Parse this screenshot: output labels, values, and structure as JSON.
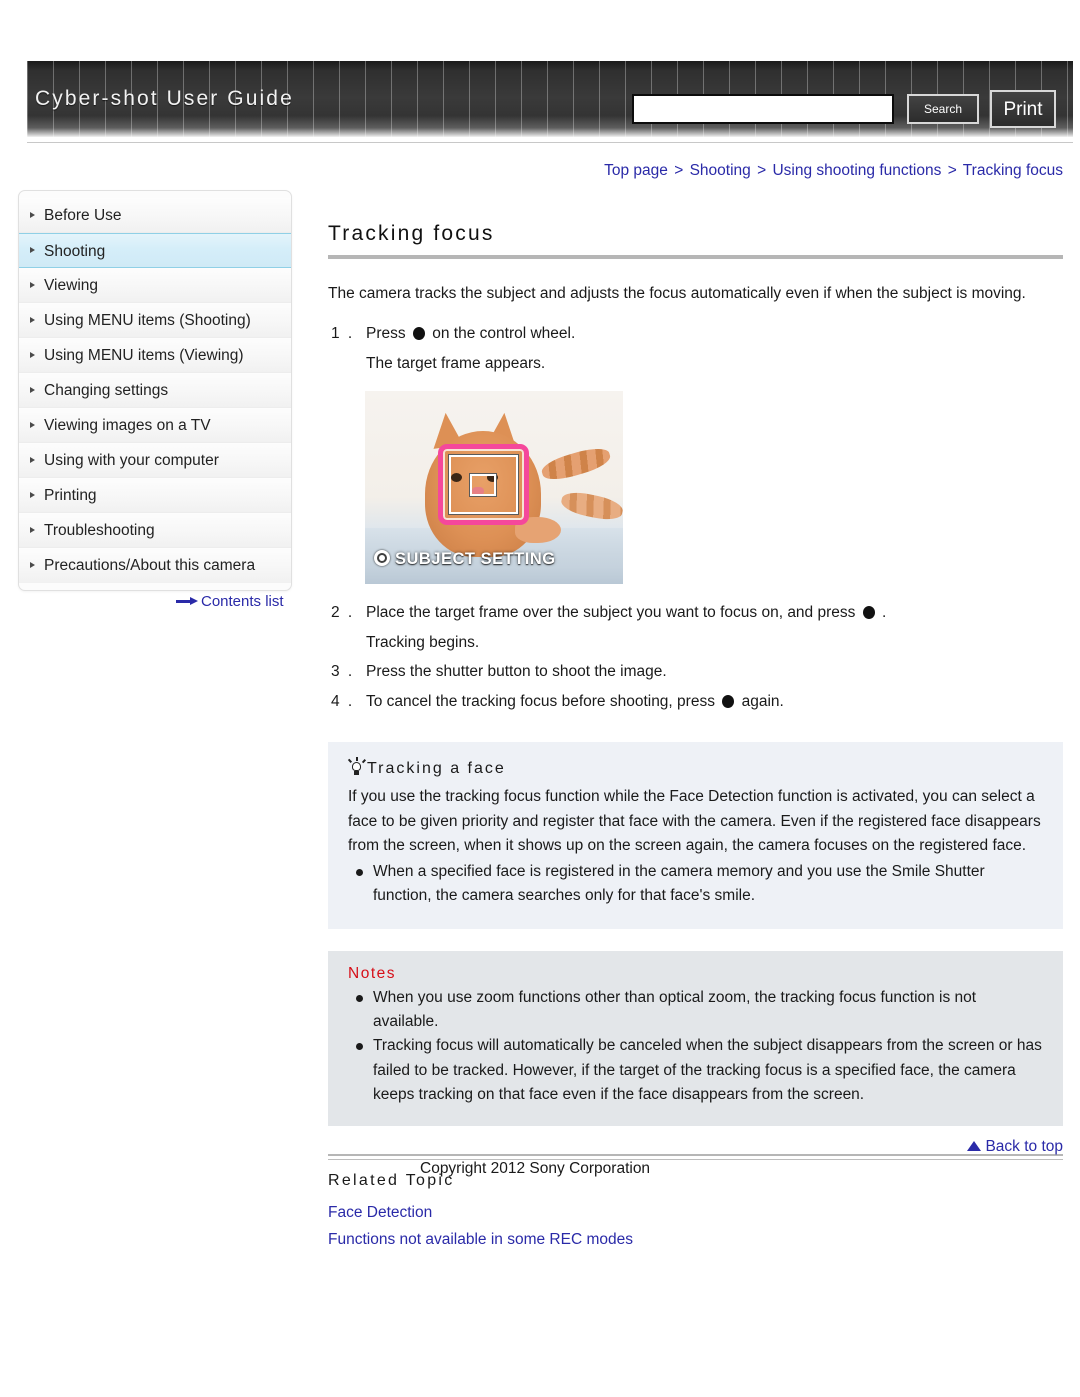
{
  "header": {
    "site_title": "Cyber-shot User Guide",
    "search_value": "",
    "search_placeholder": "",
    "search_button": "Search",
    "print_button": "Print"
  },
  "breadcrumb": {
    "items": [
      "Top page",
      "Shooting",
      "Using shooting functions",
      "Tracking focus"
    ],
    "separator": ">"
  },
  "sidebar": {
    "items": [
      {
        "label": "Before Use",
        "active": false
      },
      {
        "label": "Shooting",
        "active": true
      },
      {
        "label": "Viewing",
        "active": false
      },
      {
        "label": "Using MENU items (Shooting)",
        "active": false
      },
      {
        "label": "Using MENU items (Viewing)",
        "active": false
      },
      {
        "label": "Changing settings",
        "active": false
      },
      {
        "label": "Viewing images on a TV",
        "active": false
      },
      {
        "label": "Using with your computer",
        "active": false
      },
      {
        "label": "Printing",
        "active": false
      },
      {
        "label": "Troubleshooting",
        "active": false
      },
      {
        "label": "Precautions/About this camera",
        "active": false
      }
    ],
    "contents_list_label": "Contents list"
  },
  "main": {
    "title": "Tracking focus",
    "intro": "The camera tracks the subject and adjusts the focus automatically even if when the subject is moving.",
    "steps": [
      {
        "num": "1 .",
        "text_before": "Press",
        "has_dot": true,
        "text_after": "on the control wheel.",
        "sub": "The target frame appears."
      },
      {
        "num": "2 .",
        "text_before": "Place the target frame over the subject you want to focus on, and press",
        "has_dot": true,
        "text_after": ".",
        "sub": "Tracking begins."
      },
      {
        "num": "3 .",
        "text_before": "Press the shutter button to shoot the image.",
        "has_dot": false,
        "text_after": "",
        "sub": ""
      },
      {
        "num": "4 .",
        "text_before": "To cancel the tracking focus before shooting, press",
        "has_dot": true,
        "text_after": "again.",
        "sub": ""
      }
    ],
    "screenshot": {
      "osd_label": "SUBJECT SETTING"
    },
    "tip": {
      "title": "Tracking a face",
      "paragraph": "If you use the tracking focus function while the Face Detection function is activated, you can select a face to be given priority and register that face with the camera. Even if the registered face disappears from the screen, when it shows up on the screen again, the camera focuses on the registered face.",
      "bullets": [
        "When a specified face is registered in the camera memory and you use the Smile Shutter function, the camera searches only for that face's smile."
      ]
    },
    "notes": {
      "title": "Notes",
      "bullets": [
        "When you use zoom functions other than optical zoom, the tracking focus function is not available.",
        "Tracking focus will automatically be canceled when the subject disappears from the screen or has failed to be tracked. However, if the target of the tracking focus is a specified face, the camera keeps tracking on that face even if the face disappears from the screen."
      ]
    },
    "related": {
      "title": "Related Topic",
      "links": [
        "Face Detection",
        "Functions not available in some REC modes"
      ]
    }
  },
  "footer": {
    "back_to_top": "Back to top",
    "copyright": "Copyright 2012 Sony Corporation"
  },
  "colors": {
    "link": "#2a2aa8",
    "notes_title": "#d60f19",
    "active_nav": "#cfeaf6",
    "tip_bg": "#eef1f6",
    "notes_bg": "#e3e6e9",
    "frame_accent": "#f5489b"
  }
}
